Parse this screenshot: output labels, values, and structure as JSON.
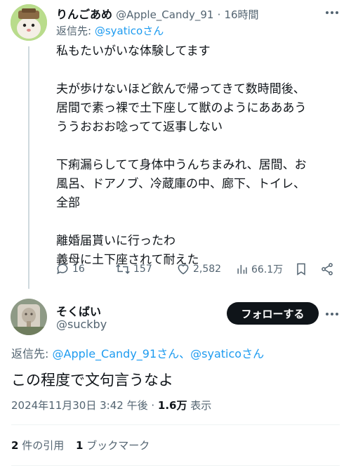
{
  "reply_tweet": {
    "display_name": "りんごあめ",
    "handle": "@Apple_Candy_91",
    "separator": "·",
    "time": "16時間",
    "reply_to_label": "返信先:",
    "reply_to_handle": "@syatico",
    "reply_to_suffix": "さん",
    "lines": [
      "私もたいがいな体験してます",
      "",
      "夫が歩けないほど飲んで帰ってきて数時間後、",
      "居間で素っ裸で土下座して獣のようにあああう",
      "ううおおお唸ってて返事しない",
      "",
      "下痢漏らしてて身体中うんちまみれ、居間、お",
      "風呂、ドアノブ、冷蔵庫の中、廊下、トイレ、",
      "全部",
      "",
      "離婚届貰いに行ったわ",
      "義母に土下座されて耐えた"
    ],
    "replies": "16",
    "reposts": "157",
    "likes": "2,582",
    "views": "66.1万"
  },
  "main_tweet": {
    "display_name": "そくばい",
    "handle": "@suckby",
    "follow_label": "フォローする",
    "reply_to_label": "返信先:",
    "reply_to_handle_1": "@Apple_Candy_91",
    "reply_to_mid": "さん、",
    "reply_to_handle_2": "@syatico",
    "reply_to_suffix": "さん",
    "text": "この程度で文句言うなよ",
    "timestamp": "2024年11月30日 3:42 午後",
    "separator": "·",
    "views_count": "1.6万",
    "views_label": "表示",
    "quote_count": "2",
    "quote_label": "件の引用",
    "bookmark_count": "1",
    "bookmark_label": "ブックマーク"
  }
}
